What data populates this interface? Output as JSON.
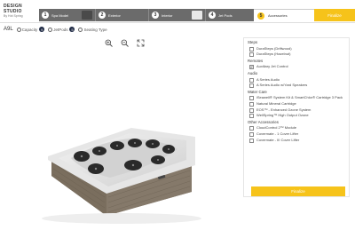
{
  "app": {
    "logo_line1": "DESIGN STUDIO",
    "logo_line2": "By Hot Spring"
  },
  "steps": [
    {
      "num": "1",
      "label": "Spa Model"
    },
    {
      "num": "2",
      "label": "Exterior"
    },
    {
      "num": "3",
      "label": "Interior"
    },
    {
      "num": "4",
      "label": "Jet Pods"
    }
  ],
  "active_step": {
    "num": "5",
    "label": "Accessories"
  },
  "finalize_label": "Finalize",
  "model_bar": {
    "model": "A9L",
    "capacity_label": "Capacity",
    "capacity_count": "9",
    "jetpods_label": "JetPods",
    "jetpods_count": "5",
    "seating_label": "Seating Type"
  },
  "zoom": {
    "zoom_in": "+",
    "zoom_out": "−",
    "expand": "⤢"
  },
  "accessories": {
    "steps_title": "Steps",
    "steps_items": [
      "DuraSteps (Driftwood)",
      "DuraSteps (Hazelnut)"
    ],
    "remotes_title": "Remotes",
    "remotes_items": [
      "Auxiliary Jet Control"
    ],
    "audio_title": "Audio",
    "audio_items": [
      "A Series Audio",
      "A Series Audio w/Yard Speakers"
    ],
    "water_title": "Water Care",
    "water_items": [
      "iSeawell® System Kit & SmartChlor® Cartridge 3 Pack",
      "Natural Mineral Cartridge",
      "EOS™ - Enhanced Ozone System",
      "WellSpring™ High Output Ozone"
    ],
    "other_title": "Other Accessories",
    "other_items": [
      "CloudControl 2™ Module",
      "Covermate - 1 Cover Lifter",
      "Covermate - III Cover Lifter"
    ]
  },
  "colors": {
    "accent": "#f6c31a",
    "stepbar": "#6b6b6b"
  }
}
